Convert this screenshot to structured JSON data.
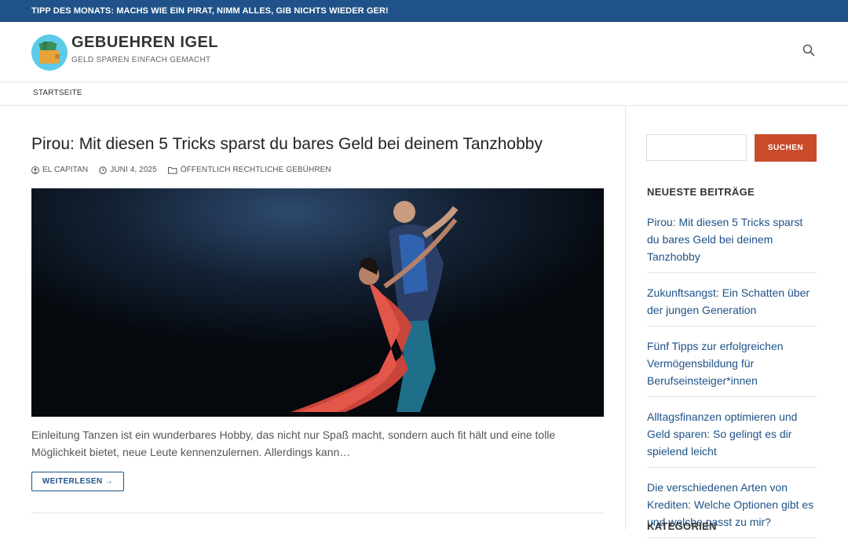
{
  "topbar": {
    "tip": "TIPP DES MONATS: MACHS WIE EIN PIRAT, NIMM ALLES, GIB NICHTS WIEDER GER!"
  },
  "site": {
    "title": "GEBUEHREN IGEL",
    "tagline": "GELD SPAREN EINFACH GEMACHT"
  },
  "nav": {
    "items": [
      {
        "label": "STARTSEITE"
      }
    ]
  },
  "post": {
    "title": "Pirou: Mit diesen 5 Tricks sparst du bares Geld bei deinem Tanzhobby",
    "author": "EL CAPITAN",
    "date": "JUNI 4, 2025",
    "category": "ÖFFENTLICH RECHTLICHE GEBÜHREN",
    "excerpt": "Einleitung Tanzen ist ein wunderbares Hobby, das nicht nur Spaß macht, sondern auch fit hält und eine tolle Möglichkeit bietet, neue Leute kennenzulernen. Allerdings kann…",
    "read_more": "WEITERLESEN →"
  },
  "sidebar": {
    "search": {
      "placeholder": "",
      "button": "SUCHEN"
    },
    "recent_title": "NEUESTE BEITRÄGE",
    "recent": [
      "Pirou: Mit diesen 5 Tricks sparst du bares Geld bei deinem Tanzhobby",
      "Zukunftsangst: Ein Schatten über der jungen Generation",
      "Fünf Tipps zur erfolgreichen Vermögensbildung für Berufseinsteiger*innen",
      "Alltagsfinanzen optimieren und Geld sparen: So gelingt es dir spielend leicht",
      "Die verschiedenen Arten von Krediten: Welche Optionen gibt es und welche passt zu mir?"
    ],
    "categories_title": "KATEGORIEN"
  },
  "colors": {
    "topbar": "#1e5288",
    "link": "#1e5288",
    "button": "#c94b2b"
  }
}
